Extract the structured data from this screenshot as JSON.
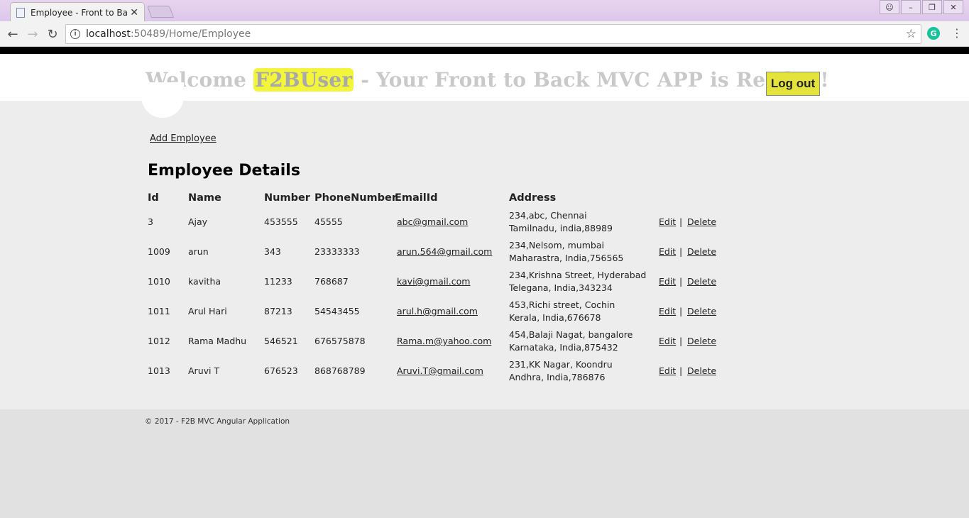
{
  "browser": {
    "tab_title": "Employee - Front to Back",
    "close": "✕",
    "url_host": "localhost",
    "url_rest": ":50489/Home/Employee",
    "grammarly": "G"
  },
  "header": {
    "welcome_prefix": "Welcome ",
    "username": "F2BUser",
    "welcome_suffix": " - Your Front to Back MVC APP is Ready !!",
    "logout_label": "Log out",
    "highlight_color": "#f2f53a"
  },
  "main": {
    "add_link": "Add Employee",
    "title": "Employee Details",
    "columns": [
      "Id",
      "Name",
      "Number",
      "PhoneNumber",
      "EmailId",
      "Address"
    ],
    "rows": [
      {
        "id": "3",
        "name": "Ajay",
        "number": "453555",
        "phone": "45555",
        "email": "abc@gmail.com",
        "addr1": "234,abc, Chennai",
        "addr2": "Tamilnadu, india,88989"
      },
      {
        "id": "1009",
        "name": "arun",
        "number": "343",
        "phone": "23333333",
        "email": "arun.564@gmail.com",
        "addr1": "234,Nelsom, mumbai",
        "addr2": "Maharastra, India,756565"
      },
      {
        "id": "1010",
        "name": "kavitha",
        "number": "11233",
        "phone": "768687",
        "email": "kavi@gmail.com",
        "addr1": "234,Krishna Street, Hyderabad",
        "addr2": "Telegana, India,343234"
      },
      {
        "id": "1011",
        "name": "Arul Hari",
        "number": "87213",
        "phone": "54543455",
        "email": "arul.h@gmail.com",
        "addr1": "453,Richi street, Cochin",
        "addr2": "Kerala, India,676678"
      },
      {
        "id": "1012",
        "name": "Rama Madhu",
        "number": "546521",
        "phone": "676575878",
        "email": "Rama.m@yahoo.com",
        "addr1": "454,Balaji Nagat, bangalore",
        "addr2": "Karnataka, India,875432"
      },
      {
        "id": "1013",
        "name": "Aruvi T",
        "number": "676523",
        "phone": "868768789",
        "email": "Aruvi.T@gmail.com",
        "addr1": "231,KK Nagar, Koondru",
        "addr2": "Andhra, India,786876"
      }
    ],
    "edit_label": "Edit",
    "separator": "|",
    "delete_label": "Delete"
  },
  "footer": {
    "text": "© 2017 - F2B MVC Angular Application"
  }
}
